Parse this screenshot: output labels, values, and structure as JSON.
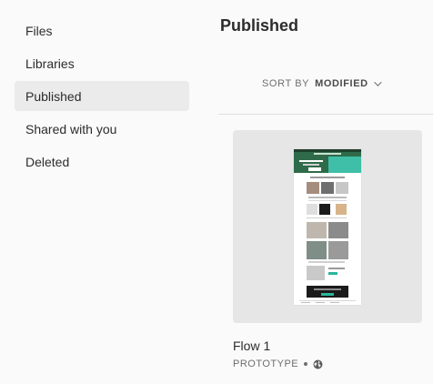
{
  "sidebar": {
    "items": [
      {
        "label": "Files"
      },
      {
        "label": "Libraries"
      },
      {
        "label": "Published",
        "selected": true
      },
      {
        "label": "Shared with you"
      },
      {
        "label": "Deleted"
      }
    ]
  },
  "main": {
    "title": "Published",
    "sort": {
      "prefix": "SORT BY",
      "value": "MODIFIED",
      "icon": "chevron-down-icon"
    },
    "cards": [
      {
        "name": "Flow 1",
        "type": "PROTOTYPE",
        "visibility_icon": "globe-icon"
      }
    ]
  },
  "colors": {
    "selected_bg": "#ebebeb",
    "card_bg": "#e6e6e6",
    "thumb_header": "#2f6b4a",
    "thumb_accent": "#2bb59c",
    "thumb_dark": "#1b1b1b"
  }
}
